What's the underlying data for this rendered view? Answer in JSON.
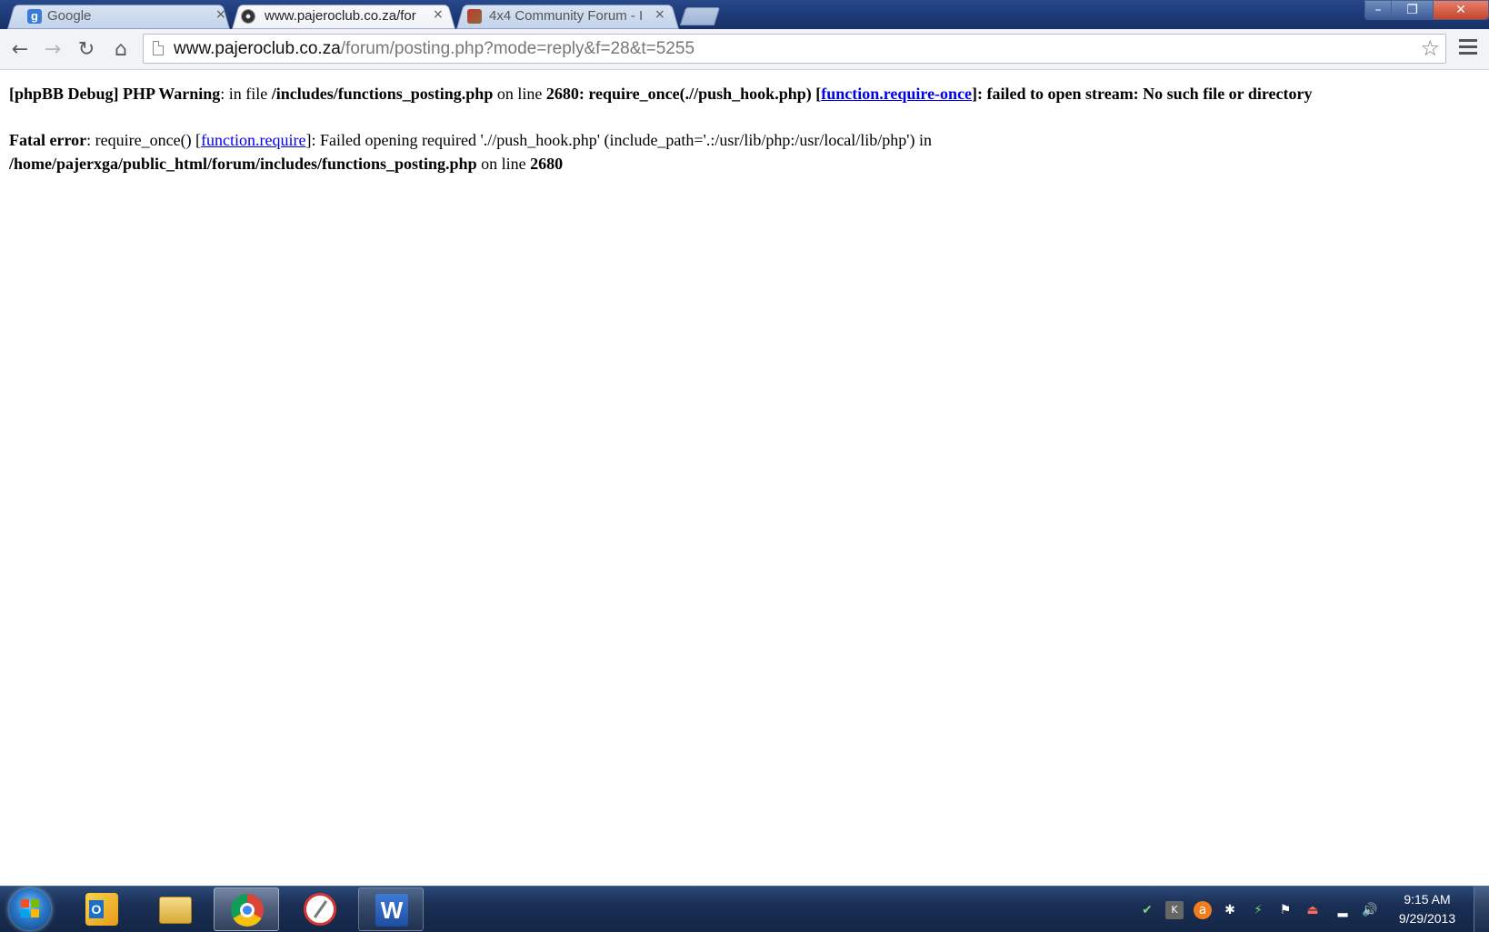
{
  "browser": {
    "tabs": [
      {
        "title": "Google",
        "favicon": "google-g-icon",
        "active": false
      },
      {
        "title": "www.pajeroclub.co.za/for",
        "favicon": "pajeroclub-favicon",
        "active": true
      },
      {
        "title": "4x4 Community Forum - I",
        "favicon": "forum-favicon",
        "active": false
      }
    ],
    "tab_close_glyph": "×",
    "window_controls": {
      "minimize": "–",
      "maximize": "❐",
      "close": "✕"
    },
    "url_host": "www.pajeroclub.co.za",
    "url_path": "/forum/posting.php?mode=reply&f=28&t=5255"
  },
  "page": {
    "warning": {
      "prefix_bold": "[phpBB Debug] PHP Warning",
      "text1": ": in file ",
      "file_bold": "/includes/functions_posting.php",
      "text2": " on line ",
      "line_bold": "2680",
      "text3_bold": ": require_once(.//push_hook.php) [",
      "link": "function.require-once",
      "text4_bold": "]: failed to open stream: No such file or directory"
    },
    "fatal": {
      "prefix_bold": "Fatal error",
      "text1": ": require_once() [",
      "link": "function.require",
      "text2": "]: Failed opening required './/push_hook.php' (include_path='.:/usr/lib/php:/usr/local/lib/php') in",
      "path_bold": "/home/pajerxga/public_html/forum/includes/functions_posting.php",
      "text3": " on line ",
      "line_bold": "2680"
    }
  },
  "taskbar": {
    "apps": [
      "outlook-icon",
      "windows-explorer-icon",
      "chrome-icon",
      "snipping-tool-icon",
      "word-icon"
    ],
    "tray": [
      "network-app-icon",
      "kaspersky-icon",
      "avast-icon",
      "bluetooth-icon",
      "power-icon",
      "action-center-flag-icon",
      "usb-eject-icon",
      "signal-bars-icon",
      "volume-icon"
    ],
    "clock_time": "9:15 AM",
    "clock_date": "9/29/2013"
  },
  "colors": {
    "link": "#0000ee",
    "titlebar": "#1f3c7a",
    "taskbar": "#1a2f55"
  }
}
